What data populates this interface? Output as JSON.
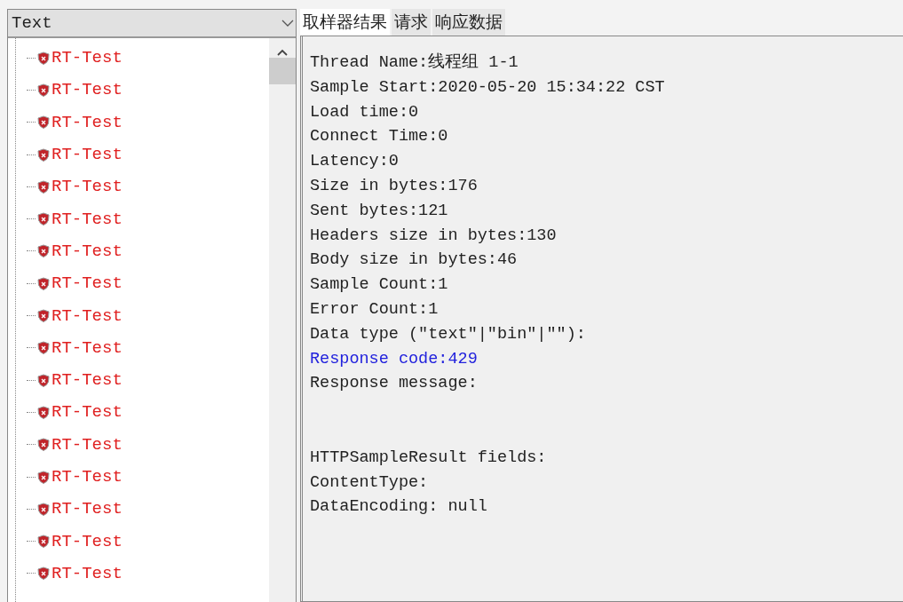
{
  "left_panel": {
    "combo": {
      "value": "Text"
    },
    "tree": [
      {
        "label": "RT-Test",
        "error": true
      },
      {
        "label": "RT-Test",
        "error": true
      },
      {
        "label": "RT-Test",
        "error": true
      },
      {
        "label": "RT-Test",
        "error": true
      },
      {
        "label": "RT-Test",
        "error": true
      },
      {
        "label": "RT-Test",
        "error": true
      },
      {
        "label": "RT-Test",
        "error": true
      },
      {
        "label": "RT-Test",
        "error": true
      },
      {
        "label": "RT-Test",
        "error": true
      },
      {
        "label": "RT-Test",
        "error": true
      },
      {
        "label": "RT-Test",
        "error": true
      },
      {
        "label": "RT-Test",
        "error": true
      },
      {
        "label": "RT-Test",
        "error": true
      },
      {
        "label": "RT-Test",
        "error": true
      },
      {
        "label": "RT-Test",
        "error": true
      },
      {
        "label": "RT-Test",
        "error": true
      },
      {
        "label": "RT-Test",
        "error": true
      }
    ]
  },
  "right_panel": {
    "tabs": [
      {
        "label": "取样器结果",
        "selected": true
      },
      {
        "label": "请求",
        "selected": false
      },
      {
        "label": "响应数据",
        "selected": false
      }
    ],
    "sections": [
      {
        "lines": [
          {
            "text": "Thread Name:线程组 1-1",
            "color": "#222222"
          },
          {
            "text": "Sample Start:2020-05-20 15:34:22 CST",
            "color": "#222222"
          },
          {
            "text": "Load time:0",
            "color": "#222222"
          },
          {
            "text": "Connect Time:0",
            "color": "#222222"
          },
          {
            "text": "Latency:0",
            "color": "#222222"
          },
          {
            "text": "Size in bytes:176",
            "color": "#222222"
          },
          {
            "text": "Sent bytes:121",
            "color": "#222222"
          },
          {
            "text": "Headers size in bytes:130",
            "color": "#222222"
          },
          {
            "text": "Body size in bytes:46",
            "color": "#222222"
          },
          {
            "text": "Sample Count:1",
            "color": "#222222"
          },
          {
            "text": "Error Count:1",
            "color": "#222222"
          },
          {
            "text": "Data type (\"text\"|\"bin\"|\"\"):",
            "color": "#222222"
          },
          {
            "text": "Response code:429",
            "color": "#2222dd"
          },
          {
            "text": "Response message:",
            "color": "#222222"
          }
        ]
      },
      {
        "lines": [
          {
            "text": "HTTPSampleResult fields:",
            "color": "#222222"
          },
          {
            "text": "ContentType:",
            "color": "#222222"
          },
          {
            "text": "DataEncoding: null",
            "color": "#222222"
          }
        ]
      }
    ]
  }
}
